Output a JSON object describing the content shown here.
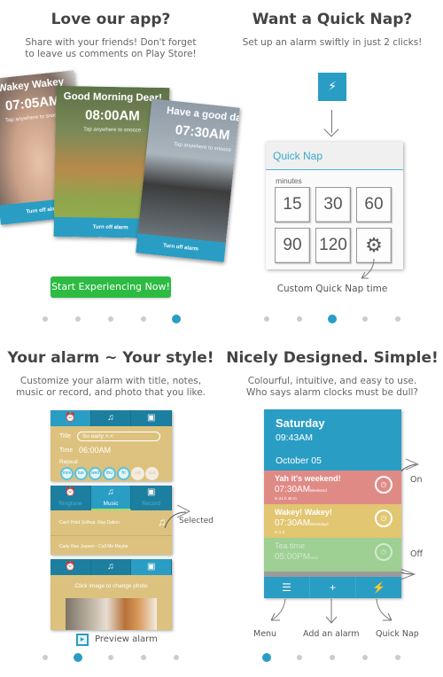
{
  "panel_love": {
    "title": "Love our app?",
    "subtitle_line1": "Share with your friends! Don't forget",
    "subtitle_line2": "to leave us comments on Play Store!",
    "cards": [
      {
        "name": "Wakey Wakey",
        "time": "07:05AM",
        "tap": "Tap anywhere to snooze",
        "button": "Turn off alarm"
      },
      {
        "name": "Good Morning Dear!",
        "time": "08:00AM",
        "tap": "Tap anywhere to snooze",
        "button": "Turn off alarm"
      },
      {
        "name": "Have a good day",
        "time": "07:30AM",
        "tap": "Tap anywhere to snooze",
        "button": "Turn off alarm"
      }
    ],
    "cta_button": "Start Experiencing Now!",
    "page_dots_total": 5,
    "page_dots_active": 5
  },
  "panel_quicknap": {
    "title": "Want a Quick Nap?",
    "subtitle": "Set up an alarm swiftly in just 2 clicks!",
    "quicknap_icon": "lightning-bolt-icon",
    "dialog_title": "Quick Nap",
    "minutes_label": "minutes",
    "options": [
      "15",
      "30",
      "60",
      "90",
      "120"
    ],
    "settings_icon": "gear-icon",
    "custom_label": "Custom Quick Nap time",
    "page_dots_total": 5,
    "page_dots_active": 3
  },
  "panel_style": {
    "title": "Your alarm ~ Your style!",
    "subtitle_line1": "Customize your alarm with title, notes,",
    "subtitle_line2": "music or record, and photo that you like.",
    "tab_icons": [
      "alarm-clock-icon",
      "music-note-icon",
      "camera-icon"
    ],
    "form": {
      "title_label": "Title",
      "title_value": "So early >.<",
      "time_label": "Time",
      "time_value": "06:00AM",
      "repeat_label": "Repeat",
      "days": [
        {
          "label": "mon",
          "on": true
        },
        {
          "label": "tue",
          "on": true
        },
        {
          "label": "wed",
          "on": true
        },
        {
          "label": "thu",
          "on": true
        },
        {
          "label": "fri",
          "on": true
        },
        {
          "label": "sat",
          "on": false
        },
        {
          "label": "sun",
          "on": false
        }
      ]
    },
    "music": {
      "tabs": [
        "Ringtone",
        "Music",
        "Record"
      ],
      "selected_tab": "Music",
      "songs": [
        "Can't Hold Us/feat. Ray Dalton",
        "Carly Rae Jepsen - Call Me Maybe"
      ],
      "selected_label": "Selected"
    },
    "photo": {
      "hint": "Click image to change photo"
    },
    "preview_label": "Preview alarm",
    "page_dots_total": 5,
    "page_dots_active": 2
  },
  "panel_design": {
    "title": "Nicely Designed. Simple!",
    "subtitle_line1": "Colourful, intuitive, and easy to use.",
    "subtitle_line2": "Who says alarm clocks must be dull?",
    "header": {
      "day": "Saturday",
      "time": "09:43AM",
      "date": "October 05"
    },
    "alarms": [
      {
        "name": "Yah it's weekend!",
        "time": "07:30AM",
        "repeat": "Weekend",
        "remaining": "in 21 h 46 m",
        "state": "on",
        "color": "#e08a86"
      },
      {
        "name": "Wakey! Wakey!",
        "time": "07:30AM",
        "repeat": "Weekdays",
        "remaining": "in 1 d",
        "state": "on",
        "color": "#e2c671"
      },
      {
        "name": "Tea time",
        "time": "05:00PM",
        "repeat": "Wed",
        "remaining": "",
        "state": "off",
        "color": "#9ecf93"
      }
    ],
    "bottom_bar": [
      "menu-icon",
      "add-icon",
      "lightning-bolt-icon"
    ],
    "callouts": {
      "on": "On",
      "off": "Off",
      "menu": "Menu",
      "add": "Add an alarm",
      "quicknap": "Quick Nap"
    },
    "page_dots_total": 5,
    "page_dots_active": 1
  },
  "colors": {
    "accent": "#2a9dc4",
    "cta_green": "#2dbb43",
    "card_tan": "#dcc27e"
  }
}
